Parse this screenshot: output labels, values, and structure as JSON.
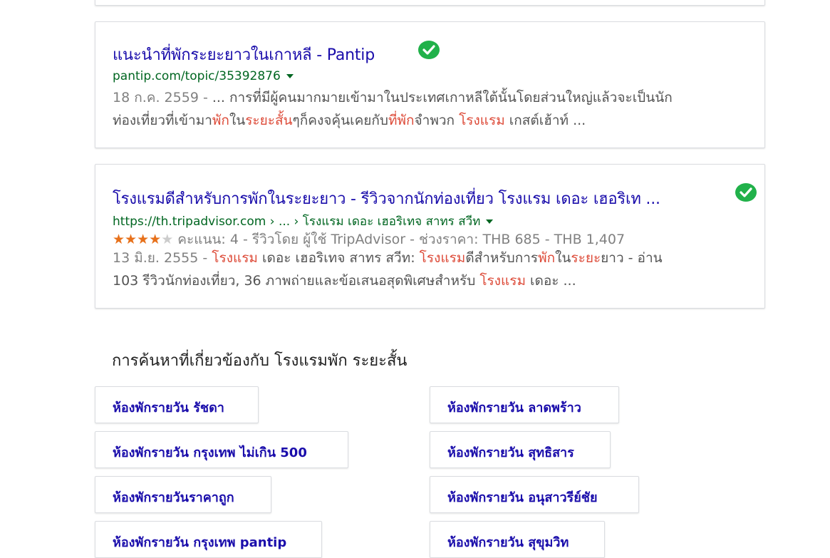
{
  "results": [
    {
      "title": "แนะนำที่พักระยะยาวในเกาหลี - Pantip",
      "url": "pantip.com/topic/35392876",
      "snippet_lines": [
        [
          {
            "text": "18 ก.ค. 2559 - ",
            "style": "date"
          },
          {
            "text": "... การที่มีผู้คนมากมายเข้ามาในประเทศเกาหลีใต้นั้นโดยส่วนใหญ่แล้วจะเป็นนัก",
            "style": "plain"
          }
        ],
        [
          {
            "text": "ท่องเที่ยวที่เข้ามา",
            "style": "plain"
          },
          {
            "text": "พัก",
            "style": "hl"
          },
          {
            "text": "ใน",
            "style": "plain"
          },
          {
            "text": "ระยะสั้น",
            "style": "hl"
          },
          {
            "text": "ๆก็คงจคุ้นเคยกับ",
            "style": "plain"
          },
          {
            "text": "ที่พัก",
            "style": "hl"
          },
          {
            "text": "จำพวก ",
            "style": "plain"
          },
          {
            "text": "โรงแรม",
            "style": "hl"
          },
          {
            "text": " เกสต์เฮ้าท์ ...",
            "style": "plain"
          }
        ]
      ]
    },
    {
      "title": "โรงแรมดีสำหรับการพักในระยะยาว - รีวิวจากนักท่องเที่ยว โรงแรม เดอะ เฮอริเท ...",
      "url": "https://th.tripadvisor.com › ... › โรงแรม เดอะ เฮอริเทจ สาทร สวีท",
      "rating": {
        "stars_filled": 4,
        "stars_total": 5,
        "text": "คะแนน: 4 - รีวิวโดย ผู้ใช้ TripAdvisor - ช่วงราคา: THB 685 - THB 1,407"
      },
      "snippet_lines": [
        [
          {
            "text": "13 มิ.ย. 2555 - ",
            "style": "date"
          },
          {
            "text": "โรงแรม",
            "style": "hl"
          },
          {
            "text": " เดอะ เฮอริเทจ สาทร สวีท: ",
            "style": "plain"
          },
          {
            "text": "โรงแรม",
            "style": "hl"
          },
          {
            "text": "ดีสำหรับการ",
            "style": "plain"
          },
          {
            "text": "พัก",
            "style": "hl"
          },
          {
            "text": "ใน",
            "style": "plain"
          },
          {
            "text": "ระยะ",
            "style": "hl"
          },
          {
            "text": "ยาว - อ่าน",
            "style": "plain"
          }
        ],
        [
          {
            "text": "103 รีวิวนักท่องเที่ยว, 36 ภาพถ่ายและข้อเสนอสุดพิเศษสำหรับ ",
            "style": "plain"
          },
          {
            "text": "โรงแรม",
            "style": "hl"
          },
          {
            "text": " เดอะ ...",
            "style": "plain"
          }
        ]
      ]
    }
  ],
  "related": {
    "title": "การค้นหาที่เกี่ยวข้องกับ โรงแรมพัก ระยะสั้น",
    "items": [
      "ห้องพักรายวัน รัชดา",
      "ห้องพักรายวัน ลาดพร้าว",
      "ห้องพักรายวัน กรุงเทพ ไม่เกิน 500",
      "ห้องพักรายวัน สุทธิสาร",
      "ห้องพักรายวันราคาถูก",
      "ห้องพักรายวัน อนุสาวรีย์ชัย",
      "ห้องพักรายวัน กรุงเทพ pantip",
      "ห้องพักรายวัน สุขุมวิท"
    ]
  },
  "colors": {
    "title_link": "#1a0dab",
    "url": "#006621",
    "highlight": "#dd4b39",
    "check_badge": "#21b14a",
    "star_filled": "#e7711b"
  },
  "icons": [
    "check-badge-icon",
    "dropdown-arrow-icon",
    "star-icon"
  ]
}
